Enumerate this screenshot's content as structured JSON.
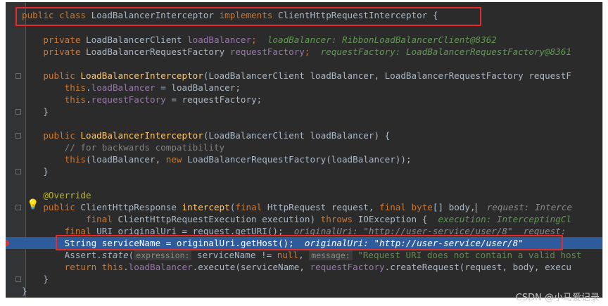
{
  "watermark": "CSDN @小马爱记录",
  "lines": {
    "l1": {
      "kw1": "public class ",
      "cls": "LoadBalancerInterceptor ",
      "kw2": "implements ",
      "rest": "ClientHttpRequestInterceptor {"
    },
    "l2": {
      "kw": "private ",
      "type": "LoadBalancerClient ",
      "field": "loadBalancer",
      "semi": ";",
      "hint": "loadBalancer: RibbonLoadBalancerClient@8362"
    },
    "l3": {
      "kw": "private ",
      "type": "LoadBalancerRequestFactory ",
      "field": "requestFactory",
      "semi": ";",
      "hint": "requestFactory: LoadBalancerRequestFactory@8361"
    },
    "l4": {
      "kw": "public ",
      "fn": "LoadBalancerInterceptor",
      "rest": "(LoadBalancerClient loadBalancer, LoadBalancerRequestFactory requestF"
    },
    "l5": {
      "kw": "this",
      "dot": ".",
      "field": "loadBalancer",
      "rest": " = loadBalancer;"
    },
    "l6": {
      "kw": "this",
      "dot": ".",
      "field": "requestFactory",
      "rest": " = requestFactory;"
    },
    "l7": {
      "rest": "}"
    },
    "l8": {
      "kw": "public ",
      "fn": "LoadBalancerInterceptor",
      "rest": "(LoadBalancerClient loadBalancer) {"
    },
    "l9": {
      "cmt": "// for backwards compatibility"
    },
    "l10": {
      "kw": "this",
      "a": "(loadBalancer, ",
      "kw2": "new ",
      "b": "LoadBalancerRequestFactory(loadBalancer));"
    },
    "l11": {
      "rest": "}"
    },
    "l12": {
      "ann": "@Override"
    },
    "l13": {
      "kw": "public ",
      "type": "ClientHttpResponse ",
      "fn": "intercept",
      "a": "(",
      "kw2": "final ",
      "b": "HttpRequest request, ",
      "kw3": "final byte",
      "c": "[] body,",
      "hint": "request: Interce"
    },
    "l14": {
      "kw": "final ",
      "a": "ClientHttpRequestExecution execution) ",
      "kw2": "throws ",
      "b": "IOException {",
      "hint": "execution: InterceptingCl"
    },
    "l15": {
      "kw": "final ",
      "a": "URI originalUri = request.getURI();",
      "hint": "originalUri: \"http://user-service/user/8\"",
      "hint2": "request:"
    },
    "l16": {
      "a": "String serviceName = originalUri.getHost();",
      "hint": "originalUri: \"http://user-service/user/8\""
    },
    "l17": {
      "a": "Assert.",
      "fn": "state",
      "b": "(",
      "tag1": "expression:",
      "c": " serviceName != ",
      "kw": "null",
      "d": ", ",
      "tag2": "message:",
      "e": " \"Request URI does not contain a valid host"
    },
    "l18": {
      "kw": "return this",
      "dot": ".",
      "field": "loadBalancer",
      "a": ".execute(serviceName, ",
      "field2": "requestFactory",
      "b": ".createRequest(request, body, execu"
    },
    "l19": {
      "rest": "}"
    },
    "l20": {
      "rest": "}"
    }
  }
}
